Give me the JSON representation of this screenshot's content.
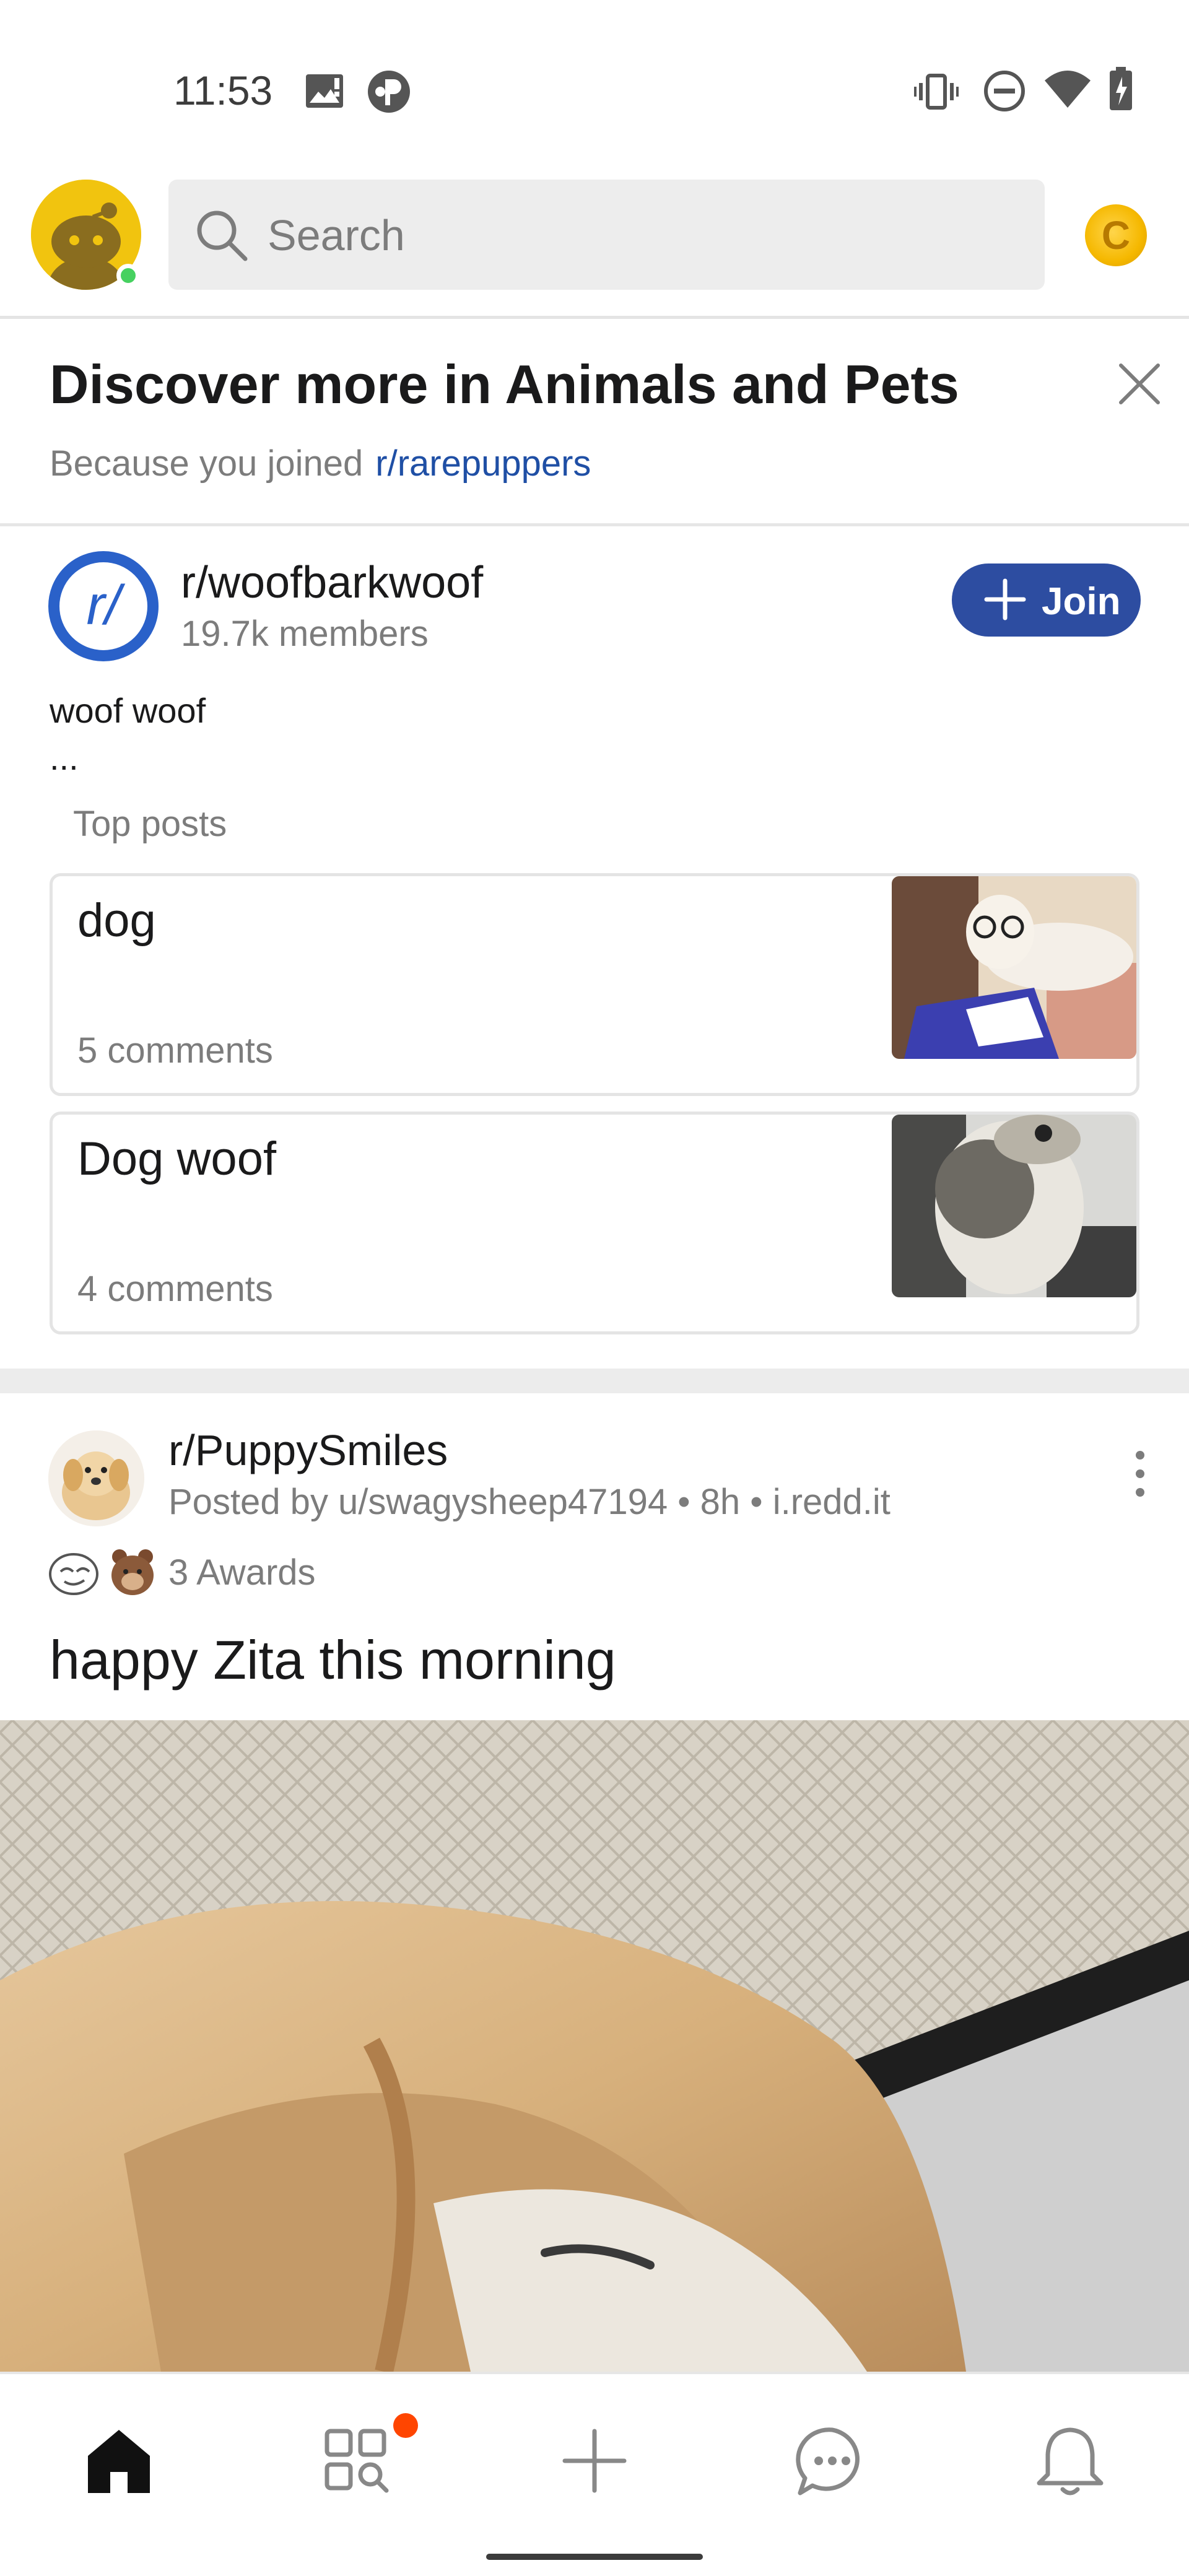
{
  "status_bar": {
    "time": "11:53"
  },
  "header": {
    "search_placeholder": "Search",
    "coin_label": "C"
  },
  "discover": {
    "title": "Discover more in Animals and Pets",
    "because_text": "Because you joined",
    "joined_subreddit": "r/rarepuppers"
  },
  "community": {
    "icon_text": "r/",
    "name": "r/woofbarkwoof",
    "members": "19.7k members",
    "join_label": "Join",
    "description": "woof woof",
    "description_more": "...",
    "top_posts_label": "Top posts",
    "top_posts": [
      {
        "title": "dog",
        "comments": "5 comments"
      },
      {
        "title": "Dog woof",
        "comments": "4 comments"
      }
    ]
  },
  "post": {
    "subreddit": "r/PuppySmiles",
    "meta": "Posted by u/swagysheep47194 • 8h • i.redd.it",
    "awards": "3 Awards",
    "title": "happy Zita this morning"
  },
  "bottom_nav": {
    "items": [
      "home-icon",
      "discover-icon",
      "create-post-icon",
      "chat-icon",
      "notifications-icon"
    ],
    "accent_color": "#ff4500"
  },
  "colors": {
    "join_button": "#2d4da1",
    "link_blue": "#1f4fa5",
    "online_green": "#46d160"
  }
}
